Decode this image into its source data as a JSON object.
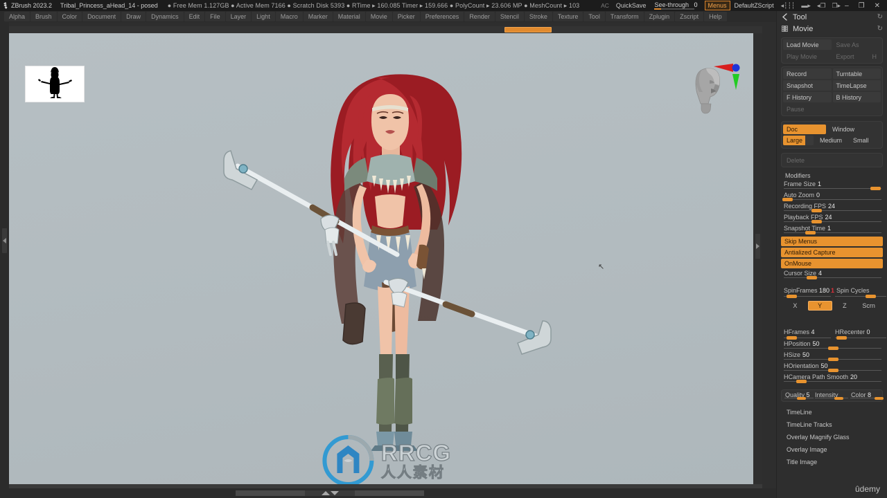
{
  "titlebar": {
    "logo_icon": "zbrush-logo-icon",
    "app_name": "ZBrush 2023.2",
    "document_name": "Tribal_Princess_aHead_14 - posed",
    "stats": "● Free Mem 1.127GB ● Active Mem 7166 ● Scratch Disk 5393 ● RTime ▸ 160.085 Timer ▸ 159.666 ● PolyCount ▸ 23.606 MP ● MeshCount ▸ 103",
    "ac_label": "AC",
    "quicksave_label": "QuickSave",
    "see_through_label": "See-through",
    "see_through_value": "0",
    "menus_label": "Menus",
    "zscript_label": "DefaultZScript",
    "icon_1": "scroll-left-icon",
    "icon_2": "scroll-right-icon",
    "icon_3": "restore-left-icon",
    "icon_4": "restore-right-icon",
    "minimize_label": "–",
    "maximize_label": "❐",
    "close_label": "✕"
  },
  "menubar": {
    "items": [
      "Alpha",
      "Brush",
      "Color",
      "Document",
      "Draw",
      "Dynamics",
      "Edit",
      "File",
      "Layer",
      "Light",
      "Macro",
      "Marker",
      "Material",
      "Movie",
      "Picker",
      "Preferences",
      "Render",
      "Stencil",
      "Stroke",
      "Texture",
      "Tool",
      "Transform",
      "Zplugin",
      "Zscript",
      "Help"
    ],
    "active_palette_label": "Tool",
    "refresh_icon": "refresh-icon"
  },
  "canvas": {
    "thumbnail_name": "document-thumbnail",
    "gizmo_name": "navigation-gizmo",
    "watermark_primary": "RRCG",
    "watermark_secondary": "人人素材",
    "cursor_glyph": "↖"
  },
  "right_panel": {
    "tool_palette": {
      "icon": "tool-icon",
      "title": "Tool",
      "refresh_icon": "refresh-icon"
    },
    "movie_palette": {
      "icon": "movie-film-icon",
      "title": "Movie",
      "refresh_icon": "refresh-icon"
    },
    "file_group": [
      {
        "label": "Load Movie",
        "enabled": true,
        "key": ""
      },
      {
        "label": "Save As",
        "enabled": false,
        "key": ""
      },
      {
        "label": "Play Movie",
        "enabled": false,
        "key": ""
      },
      {
        "label": "Export",
        "enabled": false,
        "key": "H"
      }
    ],
    "record_group": [
      {
        "label": "Record",
        "enabled": true
      },
      {
        "label": "Turntable",
        "enabled": true
      },
      {
        "label": "Snapshot",
        "enabled": true
      },
      {
        "label": "TimeLapse",
        "enabled": true
      },
      {
        "label": "F History",
        "enabled": true
      },
      {
        "label": "B History",
        "enabled": true
      }
    ],
    "pause_label": "Pause",
    "doc_row": [
      {
        "label": "Doc",
        "active": true,
        "fill": 100
      },
      {
        "label": "Window",
        "active": false,
        "fill": 0
      }
    ],
    "size_row": [
      {
        "label": "Large",
        "active": true,
        "fill": 72
      },
      {
        "label": "Medium",
        "active": false,
        "fill": 0
      },
      {
        "label": "Small",
        "active": false,
        "fill": 0
      }
    ],
    "delete_label": "Delete",
    "modifiers_title": "Modifiers",
    "modifier_sliders": [
      {
        "label": "Frame Size",
        "value": "1",
        "knob_pct": 93
      },
      {
        "label": "Auto Zoom",
        "value": "0",
        "knob_pct": 1
      },
      {
        "label": "Recording FPS",
        "value": "24",
        "knob_pct": 33
      },
      {
        "label": "Playback FPS",
        "value": "24",
        "knob_pct": 33
      },
      {
        "label": "Snapshot Time",
        "value": "1",
        "knob_pct": 26
      }
    ],
    "toggles": [
      {
        "label": "Skip Menus",
        "on": true
      },
      {
        "label": "Antialized Capture",
        "on": true
      },
      {
        "label": "OnMouse",
        "on": true
      }
    ],
    "cursor_size": {
      "label": "Cursor Size",
      "value": "4",
      "knob_pct": 27
    },
    "spin": {
      "frames_label": "SpinFrames",
      "frames_value": "180",
      "cycles_value": "1",
      "cycles_label": "Spin Cycles",
      "frames_knob_pct": 18,
      "cycles_knob_pct": 64
    },
    "axis_row": [
      {
        "label": "X",
        "active": false
      },
      {
        "label": "Y",
        "active": true
      },
      {
        "label": "Z",
        "active": false
      },
      {
        "label": "Scrn",
        "active": false
      }
    ],
    "h_sliders": [
      {
        "label": "HFrames",
        "value": "4",
        "knob_pct": 12,
        "pair": "left"
      },
      {
        "label": "HRecenter",
        "value": "0",
        "knob_pct": 2,
        "pair": "right"
      },
      {
        "label": "HPosition",
        "value": "50",
        "knob_pct": 50,
        "pair": "full"
      },
      {
        "label": "HSize",
        "value": "50",
        "knob_pct": 50,
        "pair": "full"
      },
      {
        "label": "HOrientation",
        "value": "50",
        "knob_pct": 50,
        "pair": "full"
      },
      {
        "label": "HCamera Path Smooth",
        "value": "20",
        "knob_pct": 20,
        "pair": "full"
      }
    ],
    "quality_row": [
      {
        "label": "Quality",
        "value": "5",
        "knob_pct": 52
      },
      {
        "label": "Intensity",
        "value": "",
        "knob_pct": 55
      },
      {
        "label": "Color",
        "value": "8",
        "knob_pct": 80
      }
    ],
    "sections": [
      "TimeLine",
      "TimeLine Tracks",
      "Overlay Magnify Glass",
      "Overlay Image",
      "Title Image"
    ]
  },
  "branding": {
    "udemy_label": "ûdemy"
  },
  "colors": {
    "accent": "#e8932f",
    "panel_bg": "#2e2e2e",
    "group_bg": "#333333",
    "canvas_bg": "#b3bcc0",
    "text": "#c8c8c8",
    "text_dim": "#6b6b6b",
    "red": "#e0303a"
  }
}
